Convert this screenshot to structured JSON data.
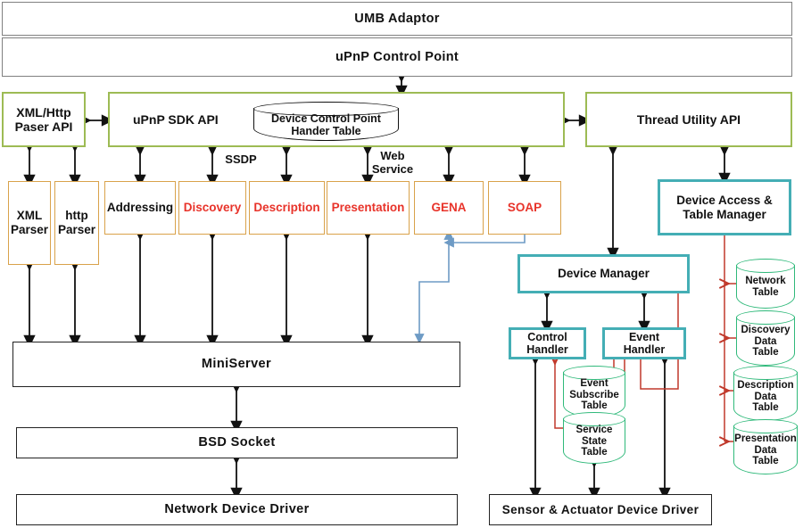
{
  "diagram": {
    "title": "UMB Adaptor uPnP stack architecture",
    "colors": {
      "grey_border": "#808080",
      "olive_border": "#9DBB54",
      "orange_border": "#D9A24A",
      "teal_border": "#44AEB5",
      "green_cylinder": "#2FB97A",
      "red_text": "#E8332A",
      "red_arrow": "#C0392B",
      "blue_arrow": "#6E9BC5",
      "black_arrow": "#111111"
    }
  },
  "layers": {
    "umb_adaptor": "UMB Adaptor",
    "upnp_control_point": "uPnP Control Point"
  },
  "apis": {
    "xml_http_parser_api": "XML/Http\nPaser API",
    "upnp_sdk_api": "uPnP SDK API",
    "device_control_point_handler_table": "Device Control Point\nHander Table",
    "thread_utility_api": "Thread Utility API"
  },
  "parsers": [
    {
      "label": "XML\nParser"
    },
    {
      "label": "http\nParser"
    }
  ],
  "protocols": [
    {
      "label": "Addressing",
      "accent": "black"
    },
    {
      "label": "Discovery",
      "accent": "red"
    },
    {
      "label": "Description",
      "accent": "red"
    },
    {
      "label": "Presentation",
      "accent": "red"
    },
    {
      "label": "GENA",
      "accent": "red"
    },
    {
      "label": "SOAP",
      "accent": "red"
    }
  ],
  "edge_labels": {
    "ssdp": "SSDP",
    "web_service": "Web\nService"
  },
  "network_stack": [
    {
      "label": "MiniServer"
    },
    {
      "label": "BSD Socket"
    },
    {
      "label": "Network Device Driver"
    }
  ],
  "device_side": {
    "device_access_table_manager": "Device Access &\nTable Manager",
    "device_manager": "Device Manager",
    "control_handler": "Control\nHandler",
    "event_handler": "Event\nHandler",
    "sensor_actuator_device_driver": "Sensor & Actuator Device Driver"
  },
  "handler_tables": [
    {
      "label": "Event\nSubscribe\nTable"
    },
    {
      "label": "Service\nState\nTable"
    }
  ],
  "data_tables": [
    {
      "label": "Network\nTable"
    },
    {
      "label": "Discovery\nData\nTable"
    },
    {
      "label": "Description\nData\nTable"
    },
    {
      "label": "Presentation\nData\nTable"
    }
  ]
}
